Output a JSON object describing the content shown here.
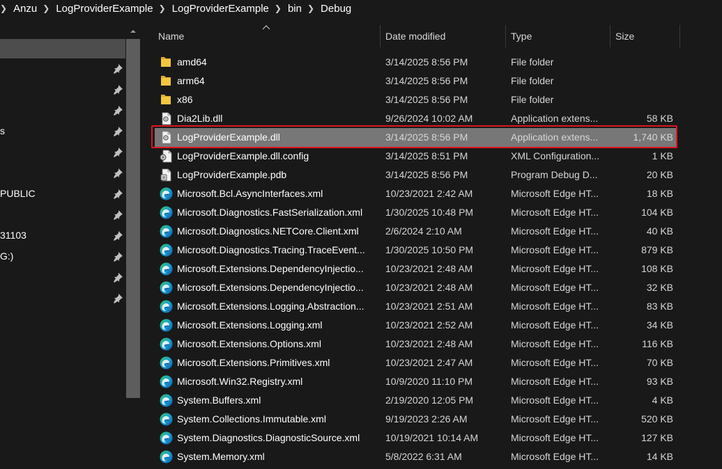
{
  "breadcrumb": [
    "Anzu",
    "LogProviderExample",
    "LogProviderExample",
    "bin",
    "Debug"
  ],
  "nav": {
    "items": [
      {
        "label": ""
      },
      {
        "label": ""
      },
      {
        "label": ""
      },
      {
        "label": "s"
      },
      {
        "label": ""
      },
      {
        "label": ""
      },
      {
        "label": "PUBLIC"
      },
      {
        "label": ""
      },
      {
        "label": "31103"
      },
      {
        "label": "G:)"
      },
      {
        "label": ""
      },
      {
        "label": ""
      }
    ]
  },
  "columns": {
    "name": "Name",
    "date": "Date modified",
    "type": "Type",
    "size": "Size"
  },
  "colors": {
    "selection": "#777777",
    "highlight_outline": "#e0141e",
    "folder": "#f3c63f",
    "edge_blue": "#0c59a4",
    "edge_green": "#35c15a"
  },
  "files": [
    {
      "icon": "folder-icon",
      "name": "amd64",
      "date": "3/14/2025 8:56 PM",
      "type": "File folder",
      "size": ""
    },
    {
      "icon": "folder-icon",
      "name": "arm64",
      "date": "3/14/2025 8:56 PM",
      "type": "File folder",
      "size": ""
    },
    {
      "icon": "folder-icon",
      "name": "x86",
      "date": "3/14/2025 8:56 PM",
      "type": "File folder",
      "size": ""
    },
    {
      "icon": "dll-file-icon",
      "name": "Dia2Lib.dll",
      "date": "9/26/2024 10:02 AM",
      "type": "Application extens...",
      "size": "58 KB"
    },
    {
      "icon": "dll-file-icon",
      "name": "LogProviderExample.dll",
      "date": "3/14/2025 8:56 PM",
      "type": "Application extens...",
      "size": "1,740 KB",
      "selected": true
    },
    {
      "icon": "config-file-icon",
      "name": "LogProviderExample.dll.config",
      "date": "3/14/2025 8:51 PM",
      "type": "XML Configuration...",
      "size": "1 KB"
    },
    {
      "icon": "pdb-file-icon",
      "name": "LogProviderExample.pdb",
      "date": "3/14/2025 8:56 PM",
      "type": "Program Debug D...",
      "size": "20 KB"
    },
    {
      "icon": "edge-icon",
      "name": "Microsoft.Bcl.AsyncInterfaces.xml",
      "date": "10/23/2021 2:42 AM",
      "type": "Microsoft Edge HT...",
      "size": "18 KB"
    },
    {
      "icon": "edge-icon",
      "name": "Microsoft.Diagnostics.FastSerialization.xml",
      "date": "1/30/2025 10:48 PM",
      "type": "Microsoft Edge HT...",
      "size": "104 KB"
    },
    {
      "icon": "edge-icon",
      "name": "Microsoft.Diagnostics.NETCore.Client.xml",
      "date": "2/6/2024 2:10 AM",
      "type": "Microsoft Edge HT...",
      "size": "40 KB"
    },
    {
      "icon": "edge-icon",
      "name": "Microsoft.Diagnostics.Tracing.TraceEvent...",
      "date": "1/30/2025 10:50 PM",
      "type": "Microsoft Edge HT...",
      "size": "879 KB"
    },
    {
      "icon": "edge-icon",
      "name": "Microsoft.Extensions.DependencyInjectio...",
      "date": "10/23/2021 2:48 AM",
      "type": "Microsoft Edge HT...",
      "size": "108 KB"
    },
    {
      "icon": "edge-icon",
      "name": "Microsoft.Extensions.DependencyInjectio...",
      "date": "10/23/2021 2:48 AM",
      "type": "Microsoft Edge HT...",
      "size": "32 KB"
    },
    {
      "icon": "edge-icon",
      "name": "Microsoft.Extensions.Logging.Abstraction...",
      "date": "10/23/2021 2:51 AM",
      "type": "Microsoft Edge HT...",
      "size": "83 KB"
    },
    {
      "icon": "edge-icon",
      "name": "Microsoft.Extensions.Logging.xml",
      "date": "10/23/2021 2:52 AM",
      "type": "Microsoft Edge HT...",
      "size": "34 KB"
    },
    {
      "icon": "edge-icon",
      "name": "Microsoft.Extensions.Options.xml",
      "date": "10/23/2021 2:48 AM",
      "type": "Microsoft Edge HT...",
      "size": "116 KB"
    },
    {
      "icon": "edge-icon",
      "name": "Microsoft.Extensions.Primitives.xml",
      "date": "10/23/2021 2:47 AM",
      "type": "Microsoft Edge HT...",
      "size": "70 KB"
    },
    {
      "icon": "edge-icon",
      "name": "Microsoft.Win32.Registry.xml",
      "date": "10/9/2020 11:10 PM",
      "type": "Microsoft Edge HT...",
      "size": "93 KB"
    },
    {
      "icon": "edge-icon",
      "name": "System.Buffers.xml",
      "date": "2/19/2020 12:05 PM",
      "type": "Microsoft Edge HT...",
      "size": "4 KB"
    },
    {
      "icon": "edge-icon",
      "name": "System.Collections.Immutable.xml",
      "date": "9/19/2023 2:26 AM",
      "type": "Microsoft Edge HT...",
      "size": "520 KB"
    },
    {
      "icon": "edge-icon",
      "name": "System.Diagnostics.DiagnosticSource.xml",
      "date": "10/19/2021 10:14 AM",
      "type": "Microsoft Edge HT...",
      "size": "127 KB"
    },
    {
      "icon": "edge-icon",
      "name": "System.Memory.xml",
      "date": "5/8/2022 6:31 AM",
      "type": "Microsoft Edge HT...",
      "size": "14 KB"
    }
  ]
}
